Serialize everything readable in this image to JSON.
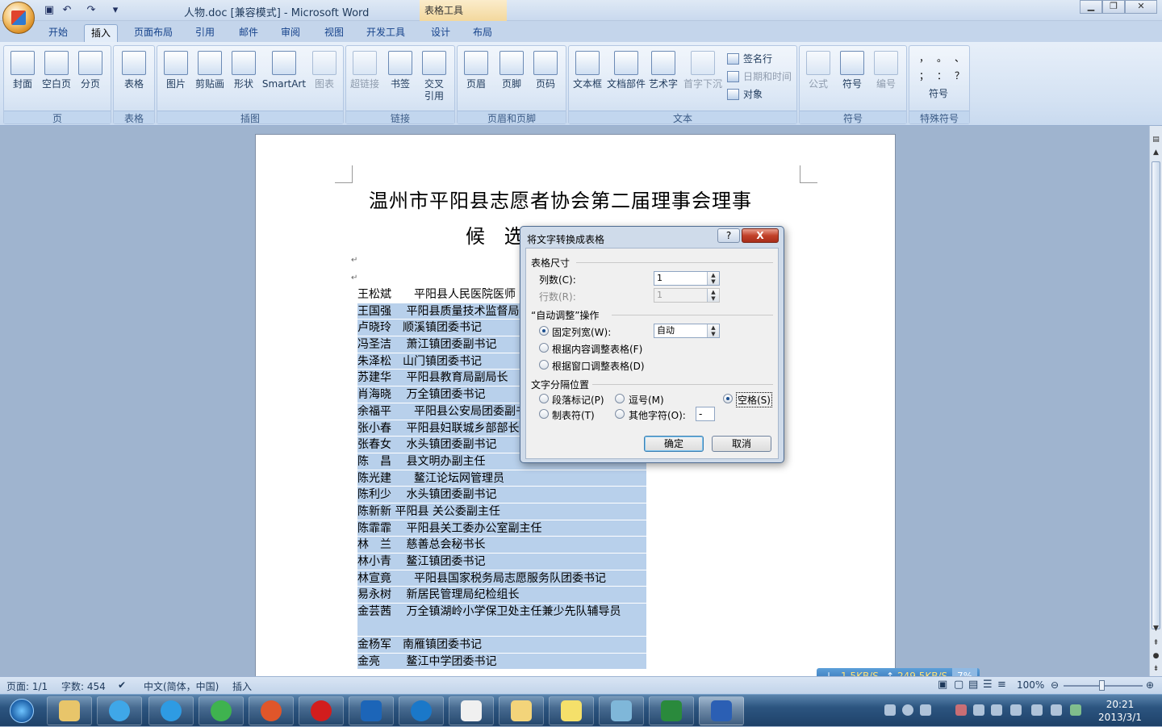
{
  "window": {
    "title": "人物.doc [兼容模式] - Microsoft Word",
    "context_tab": "表格工具",
    "qat": [
      "save-icon",
      "undo-icon",
      "redo-icon"
    ]
  },
  "tabs": [
    "开始",
    "插入",
    "页面布局",
    "引用",
    "邮件",
    "审阅",
    "视图",
    "开发工具",
    "设计",
    "布局"
  ],
  "active_tab": "插入",
  "ribbon": {
    "groups": {
      "page": "页",
      "table": "表格",
      "illustrations": "插图",
      "links": "链接",
      "header_footer": "页眉和页脚",
      "text": "文本",
      "symbols": "符号",
      "special": "特殊符号"
    },
    "buttons": {
      "cover": "封面",
      "blank_page": "空白页",
      "page_break": "分页",
      "table": "表格",
      "picture": "图片",
      "clipart": "剪贴画",
      "shapes": "形状",
      "smartart": "SmartArt",
      "chart": "图表",
      "hyperlink": "超链接",
      "bookmark": "书签",
      "crossref_1": "交叉",
      "crossref_2": "引用",
      "header": "页眉",
      "footer": "页脚",
      "page_number": "页码",
      "textbox": "文本框",
      "quickparts": "文档部件",
      "wordart": "艺术字",
      "dropcap": "首字下沉",
      "signature": "签名行",
      "datetime": "日期和时间",
      "object": "对象",
      "equation": "公式",
      "symbol": "符号",
      "numbering": "编号",
      "special_symbol": "符号"
    },
    "special_chars": [
      "，",
      "。",
      "、",
      "；",
      "：",
      "？"
    ]
  },
  "document": {
    "title_line1": "温州市平阳县志愿者协会第二届理事会理事",
    "title_line2": "候 选 人 建 议 名 单",
    "rows": [
      "王松斌　　平阳县人民医院医师",
      "王国强　 平阳县质量技术监督局",
      "卢晓玲　顺溪镇团委书记",
      "冯圣洁　 萧江镇团委副书记",
      "朱泽松　山门镇团委书记",
      "苏建华　 平阳县教育局副局长",
      "肖海晓　 万全镇团委书记",
      "余福平　　平阳县公安局团委副书记",
      "张小春　 平阳县妇联城乡部部长",
      "张春女　 水头镇团委副书记",
      "陈　昌　 县文明办副主任",
      "陈光建　　鳌江论坛网管理员",
      "陈利少　 水头镇团委副书记",
      "陈新新 平阳县 关公委副主任",
      "陈霏霏　 平阳县关工委办公室副主任",
      "林　兰　 慈善总会秘书长",
      "林小青　 鳌江镇团委书记",
      "林宣竟　　平阳县国家税务局志愿服务队团委书记",
      "易永树　 新居民管理局纪检组长",
      "金芸茜　 万全镇湖岭小学保卫处主任兼少先队辅导员",
      "金杨军　南雁镇团委书记",
      "金亮　　 鳌江中学团委书记"
    ]
  },
  "dialog": {
    "title": "将文字转换成表格",
    "help": "?",
    "close": "X",
    "section_size": "表格尺寸",
    "columns_label": "列数(C):",
    "columns_value": "1",
    "rows_label": "行数(R):",
    "rows_value": "1",
    "section_autofit": "“自动调整”操作",
    "fixed_width_label": "固定列宽(W):",
    "fixed_width_value": "自动",
    "autofit_content": "根据内容调整表格(F)",
    "autofit_window": "根据窗口调整表格(D)",
    "section_separator": "文字分隔位置",
    "sep_paragraph": "段落标记(P)",
    "sep_comma": "逗号(M)",
    "sep_space": "空格(S)",
    "sep_tab": "制表符(T)",
    "sep_other": "其他字符(O):",
    "other_char": "-",
    "ok": "确定",
    "cancel": "取消"
  },
  "status": {
    "page": "页面: 1/1",
    "words": "字数: 454",
    "language": "中文(简体，中国)",
    "mode": "插入",
    "zoom": "100%"
  },
  "netmon": {
    "down": "1.5KB/S",
    "up": "249.5KB/S",
    "cpu": "7%"
  },
  "clock": {
    "time": "20:21",
    "date": "2013/3/1"
  }
}
